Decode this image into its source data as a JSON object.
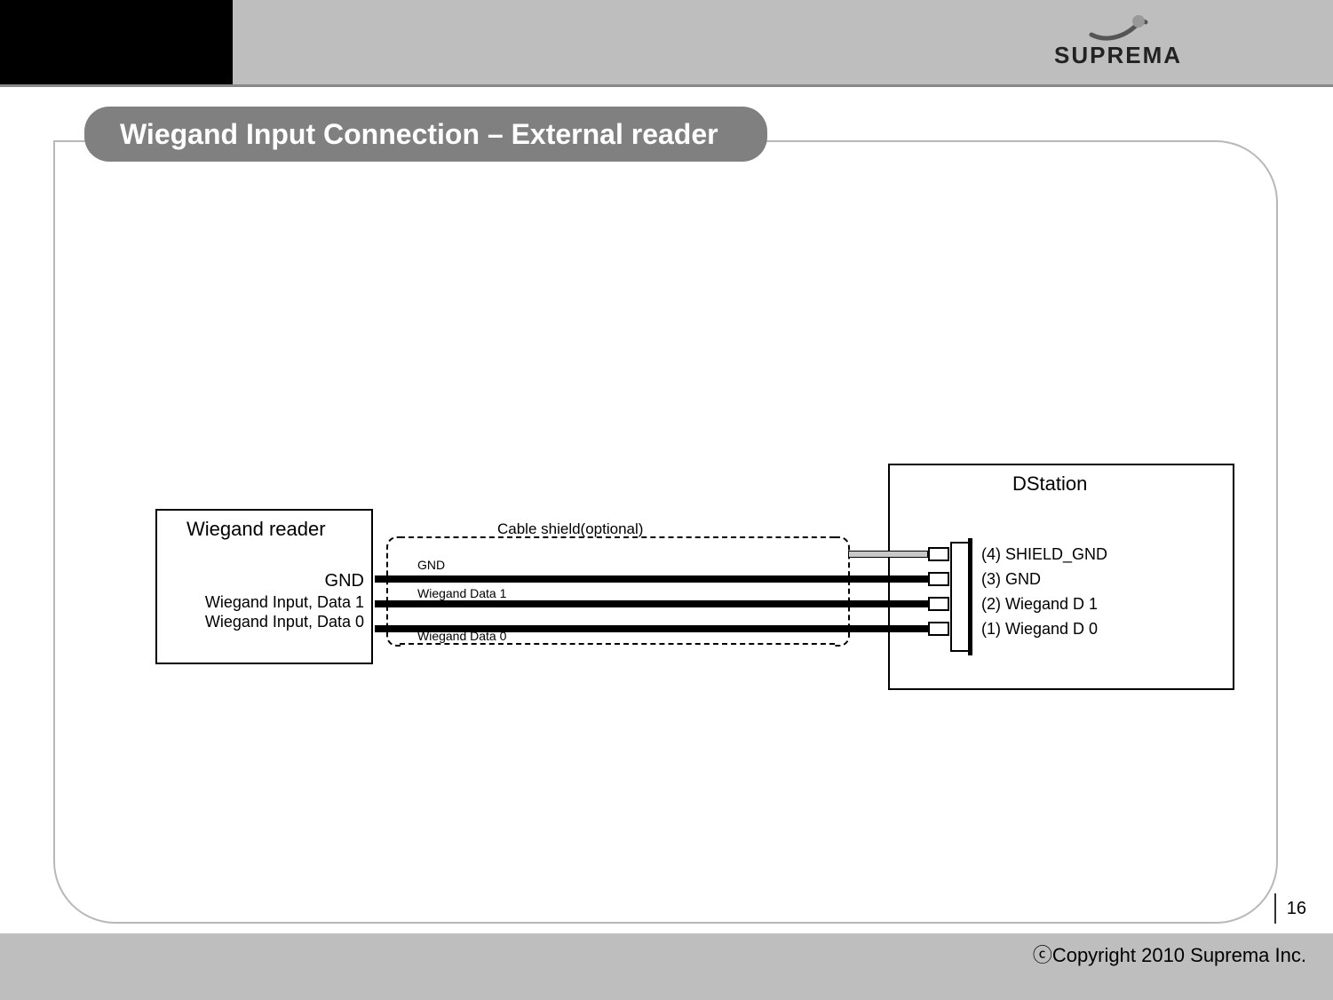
{
  "header": {
    "brand": "SUPREMA"
  },
  "title": "Wiegand Input Connection – External reader",
  "footer": {
    "page": "16",
    "copyright": "ⓒCopyright 2010 Suprema Inc."
  },
  "diagram": {
    "left_box_title": "Wiegand reader",
    "left_pins": {
      "gnd": "GND",
      "d1": "Wiegand Input, Data 1",
      "d0": "Wiegand Input, Data 0"
    },
    "shield_label": "Cable shield(optional)",
    "wire_labels": {
      "gnd": "GND",
      "d1": "Wiegand Data 1",
      "d0": "Wiegand Data 0"
    },
    "right_box_title": "DStation",
    "right_pins": {
      "p4": "(4) SHIELD_GND",
      "p3": "(3) GND",
      "p2": "(2) Wiegand D 1",
      "p1": "(1) Wiegand D 0"
    }
  },
  "chart_data": {
    "type": "table",
    "title": "Wiegand Input Connection – External reader",
    "left_device": "Wiegand reader",
    "right_device": "DStation",
    "cable_shield": "optional → SHIELD_GND (pin 4)",
    "connections": [
      {
        "wiegand_reader": "GND",
        "dstation_pin": 3,
        "dstation_signal": "GND"
      },
      {
        "wiegand_reader": "Wiegand Input, Data 1",
        "dstation_pin": 2,
        "dstation_signal": "Wiegand D 1"
      },
      {
        "wiegand_reader": "Wiegand Input, Data 0",
        "dstation_pin": 1,
        "dstation_signal": "Wiegand D 0"
      }
    ]
  }
}
